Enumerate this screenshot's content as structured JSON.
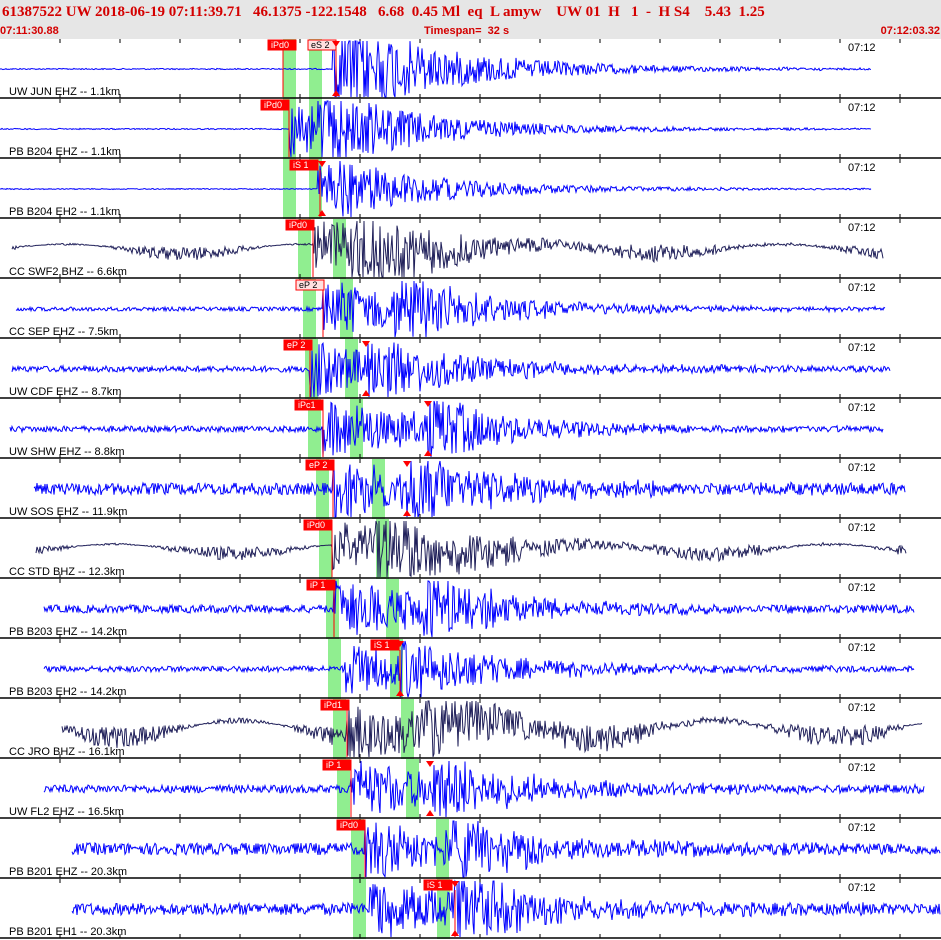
{
  "header": {
    "title": "61387522 UW 2018-06-19 07:11:39.71   46.1375 -122.1548   6.68  0.45 Ml  eq  L amyw    UW 01  H   1  -  H S4    5.43  1.25",
    "start_time": "07:11:30.88",
    "timespan": "Timespan=  32 s",
    "end_time": "07:12:03.32"
  },
  "colors": {
    "pick_red": "#ff0000",
    "green_band": "#90ee90",
    "trace_blue": "#0000ff",
    "trace_dark": "#20205a",
    "header_bg": "#e6e6e6",
    "header_text": "#d40000"
  },
  "time_label": "07:12",
  "channels": [
    {
      "label": "UW JUN EHZ -- 1.1km",
      "picks": [
        {
          "text": "iPd0"
        },
        {
          "text": "eS 2"
        }
      ]
    },
    {
      "label": "PB B204 EHZ -- 1.1km",
      "picks": [
        {
          "text": "iPd0"
        }
      ]
    },
    {
      "label": "PB B204 EH2 -- 1.1km",
      "picks": [
        {
          "text": "iS 1"
        }
      ]
    },
    {
      "label": "CC SWF2 BHZ -- 6.6km",
      "picks": [
        {
          "text": "iPd0"
        }
      ]
    },
    {
      "label": "CC SEP EHZ -- 7.5km",
      "picks": [
        {
          "text": "eP 2"
        }
      ]
    },
    {
      "label": "UW CDF EHZ -- 8.7km",
      "picks": [
        {
          "text": "eP 2"
        }
      ]
    },
    {
      "label": "UW SHW EHZ -- 8.8km",
      "picks": [
        {
          "text": "iPc1"
        }
      ]
    },
    {
      "label": "UW SOS EHZ -- 11.9km",
      "picks": [
        {
          "text": "eP 2"
        }
      ]
    },
    {
      "label": "CC STD BHZ -- 12.3km",
      "picks": [
        {
          "text": "iPd0"
        }
      ]
    },
    {
      "label": "PB B203 EHZ -- 14.2km",
      "picks": [
        {
          "text": "iP 1"
        }
      ]
    },
    {
      "label": "PB B203 EH2 -- 14.2km",
      "picks": [
        {
          "text": "iS 1"
        }
      ]
    },
    {
      "label": "CC JRO BHZ -- 16.1km",
      "picks": [
        {
          "text": "iPd1"
        }
      ]
    },
    {
      "label": "UW FL2 EHZ -- 16.5km",
      "picks": [
        {
          "text": "iP 1"
        }
      ]
    },
    {
      "label": "PB B201 EHZ -- 20.3km",
      "picks": [
        {
          "text": "iPd0"
        }
      ]
    },
    {
      "label": "PB B201 EH1 -- 20.3km",
      "picks": [
        {
          "text": "iS 1"
        }
      ]
    }
  ]
}
